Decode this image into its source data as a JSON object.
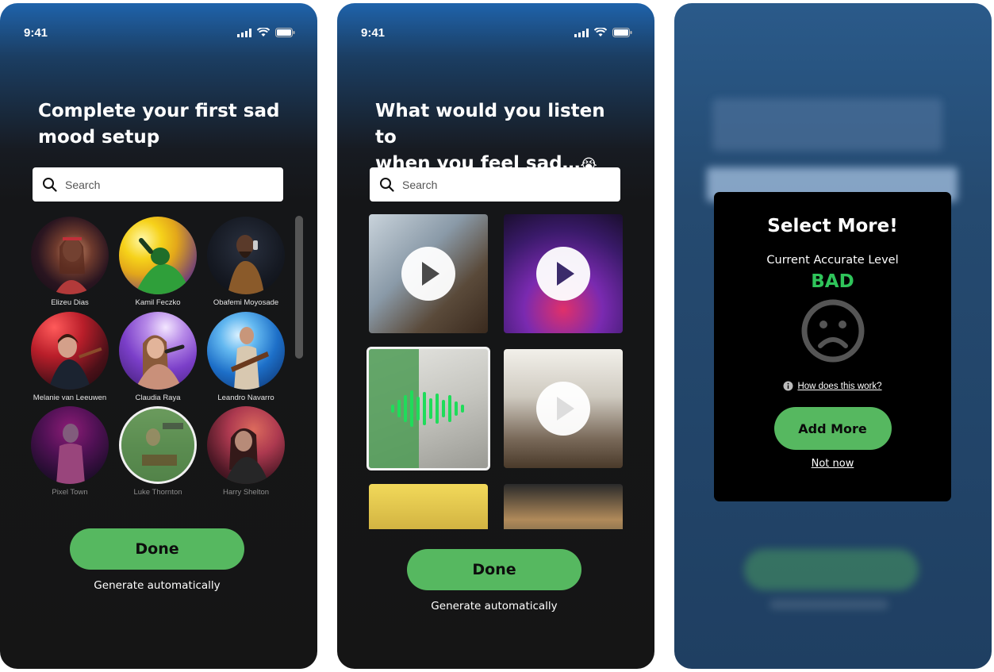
{
  "screen1": {
    "time": "9:41",
    "title_line1": "Complete your first sad",
    "title_line2": "mood setup",
    "search_placeholder": "Search",
    "artists": [
      {
        "name": "Elizeu Dias"
      },
      {
        "name": "Kamil Feczko"
      },
      {
        "name": "Obafemi Moyosade"
      },
      {
        "name": "Melanie van Leeuwen"
      },
      {
        "name": "Claudia Raya"
      },
      {
        "name": "Leandro Navarro"
      },
      {
        "name": "Pixel Town"
      },
      {
        "name": "Luke Thornton"
      },
      {
        "name": "Harry Shelton"
      }
    ],
    "done_label": "Done",
    "generate_label": "Generate automatically"
  },
  "screen2": {
    "time": "9:41",
    "title_line1": "What would you listen to",
    "title_line2": "when you feel sad…",
    "title_emoji": "😭",
    "search_placeholder": "Search",
    "done_label": "Done",
    "generate_label": "Generate automatically"
  },
  "screen3": {
    "modal_title": "Select More!",
    "modal_subtitle": "Current Accurate Level",
    "level": "BAD",
    "how_link": "How does this work?",
    "add_more_label": "Add More",
    "not_now_label": "Not now"
  },
  "colors": {
    "accent_green": "#56b860",
    "level_green": "#2fc45a",
    "background": "#151515",
    "gradient_top": "#1f63ab"
  },
  "icons": [
    "signal-icon",
    "wifi-icon",
    "battery-icon",
    "search-icon",
    "play-icon",
    "sad-face-icon",
    "info-icon",
    "soundwave-icon"
  ]
}
